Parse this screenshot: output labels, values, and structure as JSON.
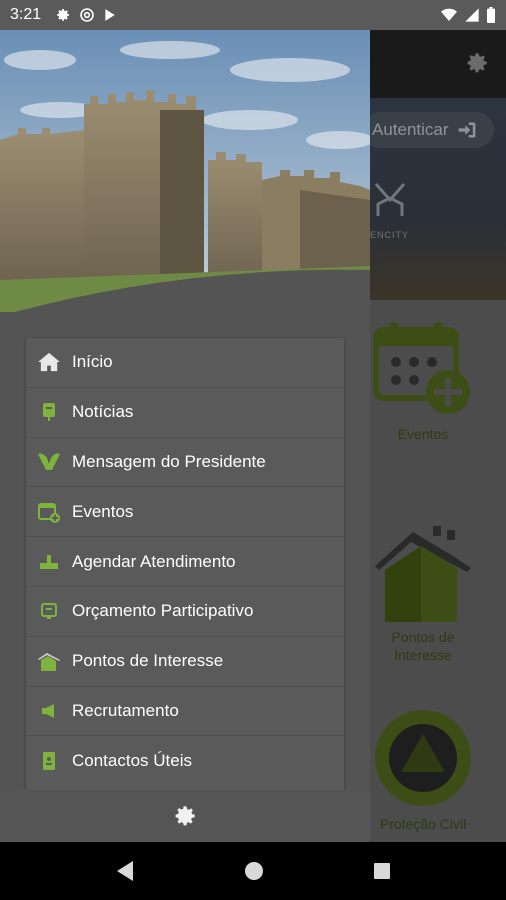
{
  "status_bar": {
    "time": "3:21"
  },
  "app": {
    "auth_label": "Autenticar",
    "brand_fragment": "ENCITY",
    "grid": [
      {
        "label": "Eventos"
      },
      {
        "label": "Pontos de Interesse"
      },
      {
        "label": "Proteção Civil"
      }
    ]
  },
  "drawer": {
    "menu": [
      {
        "label": "Início",
        "icon": "home-icon"
      },
      {
        "label": "Notícias",
        "icon": "news-icon"
      },
      {
        "label": "Mensagem do Presidente",
        "icon": "message-icon"
      },
      {
        "label": "Eventos",
        "icon": "calendar-icon"
      },
      {
        "label": "Agendar Atendimento",
        "icon": "schedule-icon"
      },
      {
        "label": "Orçamento Participativo",
        "icon": "budget-icon"
      },
      {
        "label": "Pontos de Interesse",
        "icon": "castle-icon"
      },
      {
        "label": "Recrutamento",
        "icon": "megaphone-icon"
      },
      {
        "label": "Contactos Úteis",
        "icon": "contacts-icon"
      }
    ]
  },
  "colors": {
    "accent": "#7eb33d",
    "drawer_bg": "#545454",
    "menu_bg": "#5a5a5a"
  }
}
